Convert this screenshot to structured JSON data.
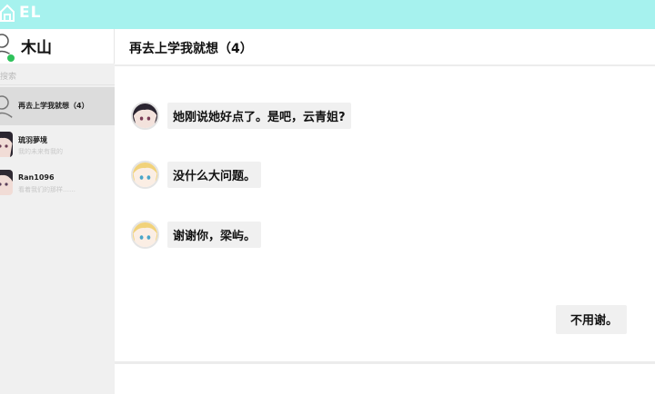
{
  "app": {
    "brand": "EL"
  },
  "user": {
    "name": "木山",
    "status_color": "#2fc25b"
  },
  "search": {
    "placeholder": "搜索"
  },
  "contacts": [
    {
      "name": "再去上学我就想（4）",
      "preview": "",
      "active": true
    },
    {
      "name": "琉羽夢境",
      "preview": "我的未来有我的",
      "active": false
    },
    {
      "name": "Ran1096",
      "preview": "看着我们的那样……",
      "active": false
    }
  ],
  "chat": {
    "title": "再去上学我就想（4）",
    "messages": [
      {
        "sender": "dark-hair-girl",
        "side": "left",
        "text": "她刚说她好点了。是吧，云青姐?"
      },
      {
        "sender": "blonde-girl",
        "side": "left",
        "text": "没什么大问题。"
      },
      {
        "sender": "blonde-girl",
        "side": "left",
        "text": "谢谢你，梁屿。"
      },
      {
        "sender": "self",
        "side": "right",
        "text": "不用谢。"
      }
    ]
  },
  "colors": {
    "topbar": "#a6f2ee",
    "sidebar": "#f0f0f0",
    "active_contact": "#dcdcdc",
    "bubble": "#f0f0f0"
  },
  "icons": {
    "brand": "house-logo-icon",
    "user_avatar": "default-user-icon"
  }
}
